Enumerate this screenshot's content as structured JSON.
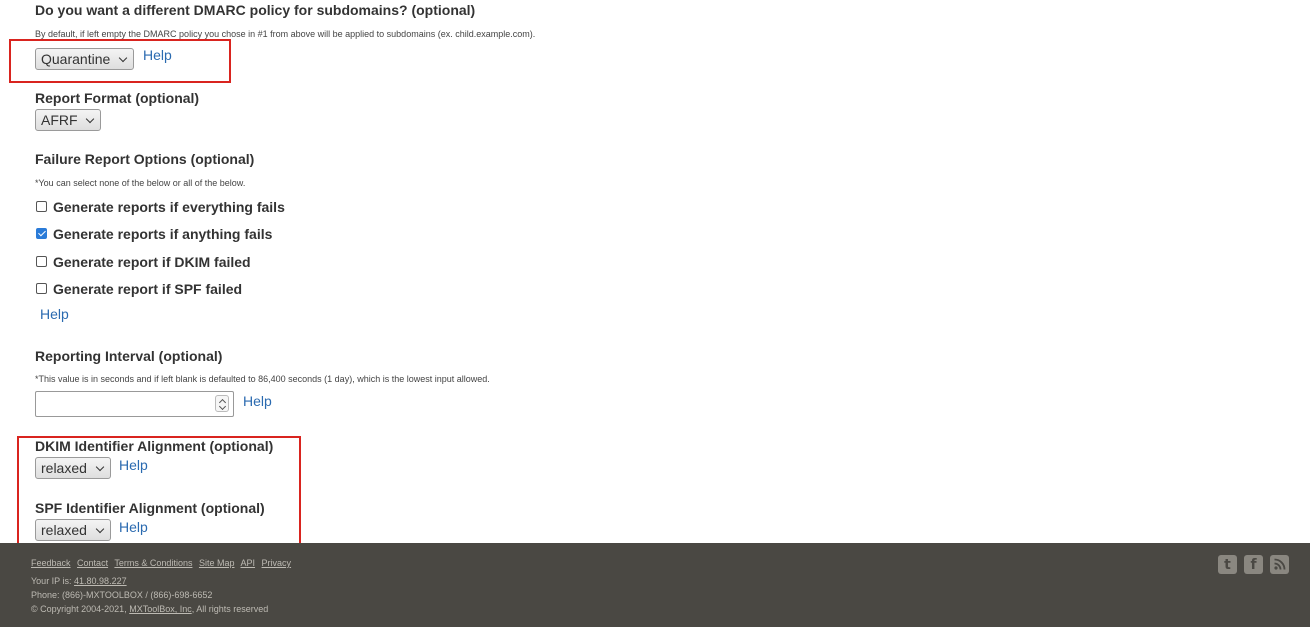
{
  "subdomain": {
    "title": "Do you want a different DMARC policy for subdomains? (optional)",
    "note": "By default, if left empty the DMARC policy you chose in #1 from above will be applied to subdomains (ex. child.example.com).",
    "select_value": "Quarantine",
    "help": "Help"
  },
  "report_format": {
    "title": "Report Format (optional)",
    "select_value": "AFRF"
  },
  "failure_options": {
    "title": "Failure Report Options (optional)",
    "note": "*You can select none of the below or all of the below.",
    "options": [
      {
        "label": "Generate reports if everything fails",
        "checked": false
      },
      {
        "label": "Generate reports if anything fails",
        "checked": true
      },
      {
        "label": "Generate report if DKIM failed",
        "checked": false
      },
      {
        "label": "Generate report if SPF failed",
        "checked": false
      }
    ],
    "help": "Help"
  },
  "interval": {
    "title": "Reporting Interval (optional)",
    "note": "*This value is in seconds and if left blank is defaulted to 86,400 seconds (1 day), which is the lowest input allowed.",
    "value": "",
    "help": "Help"
  },
  "dkim_alignment": {
    "title": "DKIM Identifier Alignment (optional)",
    "select_value": "relaxed",
    "help": "Help"
  },
  "spf_alignment": {
    "title": "SPF Identifier Alignment (optional)",
    "select_value": "relaxed",
    "help": "Help"
  },
  "footer": {
    "links": [
      "Feedback",
      "Contact",
      "Terms & Conditions",
      "Site Map",
      "API",
      "Privacy"
    ],
    "ip_label": "Your IP is: ",
    "ip_value": "41.80.98.227",
    "phone": "Phone: (866)-MXTOOLBOX / (866)-698-6652",
    "copyright_prefix": "© Copyright 2004-2021, ",
    "company": "MXToolBox, Inc",
    "copyright_suffix": ", All rights reserved",
    "social_icons": [
      "twitter-icon",
      "facebook-icon",
      "rss-icon"
    ]
  },
  "colors": {
    "link": "#2a6ab0",
    "highlight": "#d9241f",
    "footer_bg": "#4a4843",
    "checkbox_checked": "#2a7bd8"
  }
}
